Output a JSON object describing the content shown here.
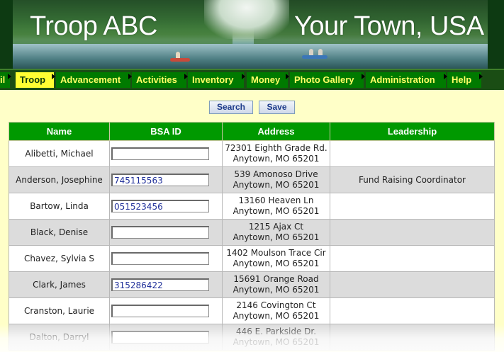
{
  "header": {
    "title_left": "Troop ABC",
    "title_right": "Your Town, USA"
  },
  "nav": {
    "items": [
      {
        "label": "il"
      },
      {
        "label": "Troop",
        "active": true
      },
      {
        "label": "Advancement"
      },
      {
        "label": "Activities"
      },
      {
        "label": "Inventory"
      },
      {
        "label": "Money"
      },
      {
        "label": "Photo Gallery"
      },
      {
        "label": "Administration"
      },
      {
        "label": "Help"
      }
    ]
  },
  "actions": {
    "search_label": "Search",
    "save_label": "Save"
  },
  "table": {
    "columns": [
      "Name",
      "BSA ID",
      "Address",
      "Leadership"
    ],
    "rows": [
      {
        "name": "Alibetti, Michael",
        "bsa_id": "",
        "address_line1": "72301 Eighth Grade Rd.",
        "address_line2": "Anytown, MO 65201",
        "leadership": ""
      },
      {
        "name": "Anderson, Josephine",
        "bsa_id": "745115563",
        "address_line1": "539 Amonoso Drive",
        "address_line2": "Anytown, MO 65201",
        "leadership": "Fund Raising Coordinator"
      },
      {
        "name": "Bartow, Linda",
        "bsa_id": "051523456",
        "address_line1": "13160 Heaven Ln",
        "address_line2": "Anytown, MO 65201",
        "leadership": ""
      },
      {
        "name": "Black, Denise",
        "bsa_id": "",
        "address_line1": "1215 Ajax Ct",
        "address_line2": "Anytown, MO 65201",
        "leadership": ""
      },
      {
        "name": "Chavez, Sylvia S",
        "bsa_id": "",
        "address_line1": "1402 Moulson Trace Cir",
        "address_line2": "Anytown, MO 65201",
        "leadership": ""
      },
      {
        "name": "Clark, James",
        "bsa_id": "315286422",
        "address_line1": "15691 Orange Road",
        "address_line2": "Anytown, MO 65201",
        "leadership": ""
      },
      {
        "name": "Cranston, Laurie",
        "bsa_id": "",
        "address_line1": "2146 Covington Ct",
        "address_line2": "Anytown, MO 65201",
        "leadership": ""
      },
      {
        "name": "Dalton, Darryl",
        "bsa_id": "",
        "address_line1": "446 E. Parkside Dr.",
        "address_line2": "Anytown, MO 65201",
        "leadership": ""
      }
    ]
  }
}
